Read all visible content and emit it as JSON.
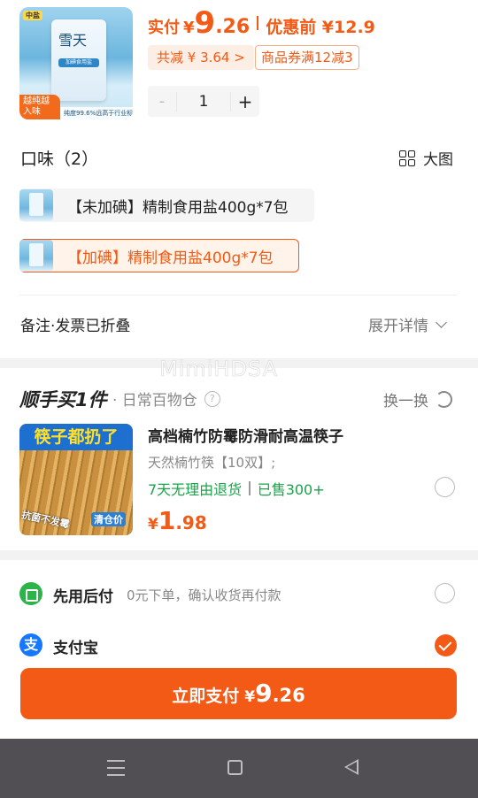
{
  "product": {
    "thumb_brand": "雪天",
    "thumb_tag": "中盐",
    "thumb_bar": "加碘食用盐",
    "thumb_badge": "越纯越入味",
    "thumb_strip": "纯度99.6%远高于行业标准",
    "price_label": "实付",
    "price_currency": "¥",
    "price_int": "9",
    "price_dec": ".26",
    "pre_price": "优惠前 ¥12.9",
    "discount_chip": "共减 ¥ 3.64 >",
    "coupon_chip": "商品券满12减3",
    "qty_minus": "-",
    "qty_value": "1",
    "qty_plus": "+"
  },
  "flavor": {
    "title": "口味（2）",
    "big_pic": "大图",
    "options": [
      {
        "label": "【未加碘】精制食用盐400g*7包",
        "selected": false
      },
      {
        "label": "【加碘】精制食用盐400g*7包",
        "selected": true
      }
    ]
  },
  "remark": {
    "label": "备注·发票已折叠",
    "expand": "展开详情"
  },
  "watermark": "MimiHDSA",
  "addon": {
    "title": "顺手买1件",
    "subtitle": "· 日常百物仓",
    "help": "?",
    "swap": "换一换",
    "image_head": "筷子都扔了",
    "image_foot_left": "抗菌不发霉",
    "image_foot_right": "清仓价",
    "name": "高档楠竹防霉防滑耐高温筷子",
    "spec": "天然楠竹筷【10双】;",
    "return_policy": "7天无理由退货",
    "sold": "已售300+",
    "price_currency": "¥",
    "price_int": "1",
    "price_dec": ".98"
  },
  "payment": {
    "options": [
      {
        "label": "先用后付",
        "sub": "0元下单，确认收货再付款",
        "icon": "credit-later-icon",
        "selected": false
      },
      {
        "label": "支付宝",
        "sub": "",
        "icon": "alipay-icon",
        "icon_glyph": "支",
        "selected": true
      }
    ],
    "button_label": "立即支付",
    "button_currency": "¥",
    "button_int": "9",
    "button_dec": ".26"
  },
  "colors": {
    "accent": "#f25a16",
    "green": "#1aa34a",
    "alipay": "#1678ff",
    "navbar": "#514f53"
  }
}
